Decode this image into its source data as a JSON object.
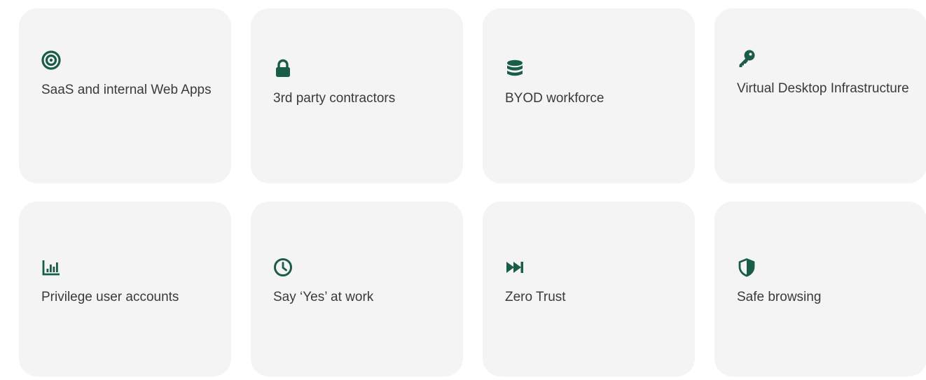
{
  "cards": [
    {
      "label": "SaaS and internal Web Apps",
      "icon": "target-icon"
    },
    {
      "label": "3rd party contractors",
      "icon": "lock-icon"
    },
    {
      "label": "BYOD workforce",
      "icon": "database-icon"
    },
    {
      "label": "Virtual Desktop Infrastructure",
      "icon": "key-icon"
    },
    {
      "label": "Privilege user accounts",
      "icon": "bar-chart-icon"
    },
    {
      "label": "Say ‘Yes’ at work",
      "icon": "clock-icon"
    },
    {
      "label": "Zero Trust",
      "icon": "fast-forward-icon"
    },
    {
      "label": "Safe browsing",
      "icon": "shield-icon"
    }
  ],
  "colors": {
    "card_background": "#f4f4f4",
    "icon": "#1a5c4a",
    "text": "#3a3a3a"
  }
}
